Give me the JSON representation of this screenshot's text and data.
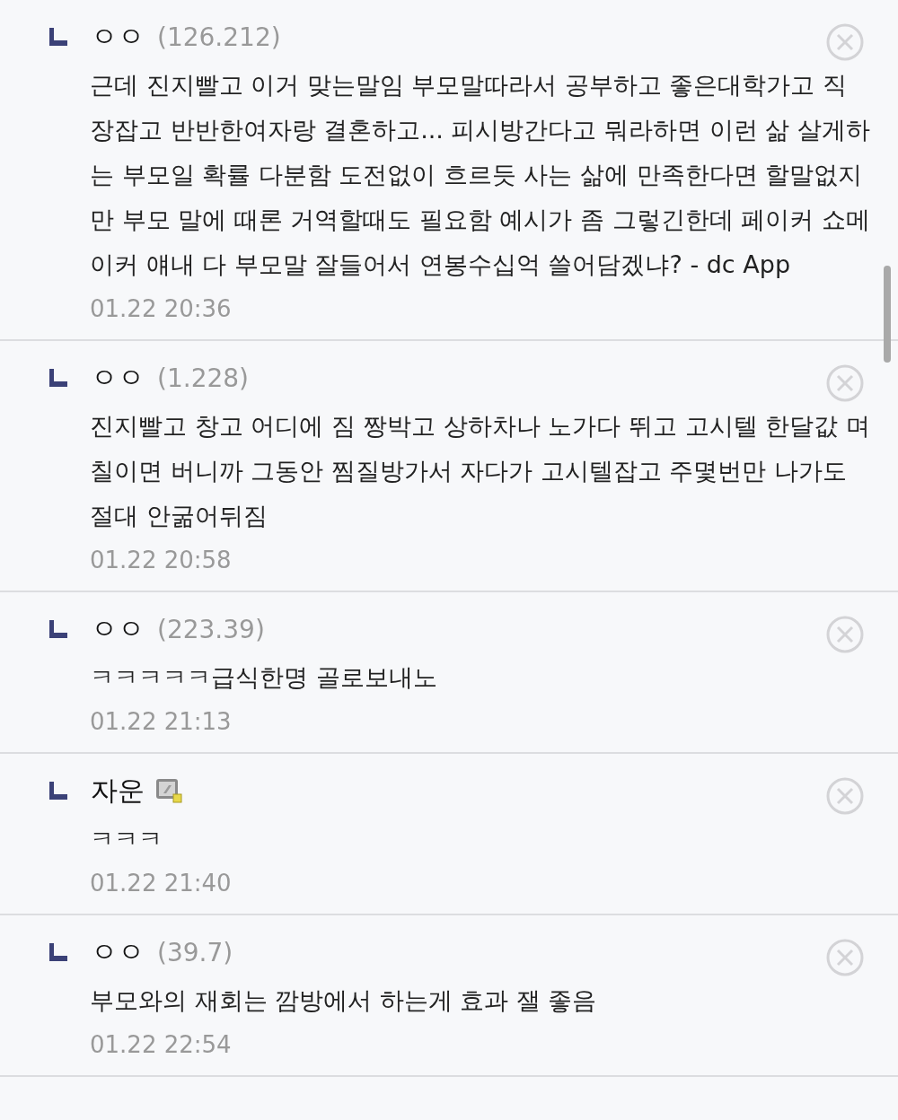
{
  "comments": [
    {
      "author": "ㅇㅇ",
      "ip": "(126.212)",
      "nick_icon": false,
      "text": "근데 진지빨고 이거 맞는말임 부모말따라서 공부하고 좋은대학가고 직장잡고 반반한여자랑 결혼하고... 피시방간다고 뭐라하면 이런 삶 살게하는 부모일 확률 다분함 도전없이 흐르듯 사는 삶에 만족한다면 할말없지만 부모 말에 때론 거역할때도 필요함 예시가 좀 그렇긴한데 페이커 쇼메이커 얘내 다 부모말 잘들어서 연봉수십억 쓸어담겠냐? - dc App",
      "date": "01.22 20:36"
    },
    {
      "author": "ㅇㅇ",
      "ip": "(1.228)",
      "nick_icon": false,
      "text": "진지빨고 창고 어디에 짐 짱박고 상하차나 노가다 뛰고 고시텔 한달값 며칠이면 버니까 그동안 찜질방가서 자다가 고시텔잡고 주몇번만 나가도 절대 안굶어뒤짐",
      "date": "01.22 20:58"
    },
    {
      "author": "ㅇㅇ",
      "ip": "(223.39)",
      "nick_icon": false,
      "text": "ㅋㅋㅋㅋㅋ급식한명 골로보내노",
      "date": "01.22 21:13"
    },
    {
      "author": "자운",
      "nick_icon": true,
      "text": "ㅋㅋㅋ",
      "date": "01.22 21:40"
    },
    {
      "author": "ㅇㅇ",
      "ip": "(39.7)",
      "nick_icon": false,
      "text": "부모와의 재회는 깜방에서 하는게 효과 잴 좋음",
      "date": "01.22 22:54"
    }
  ]
}
